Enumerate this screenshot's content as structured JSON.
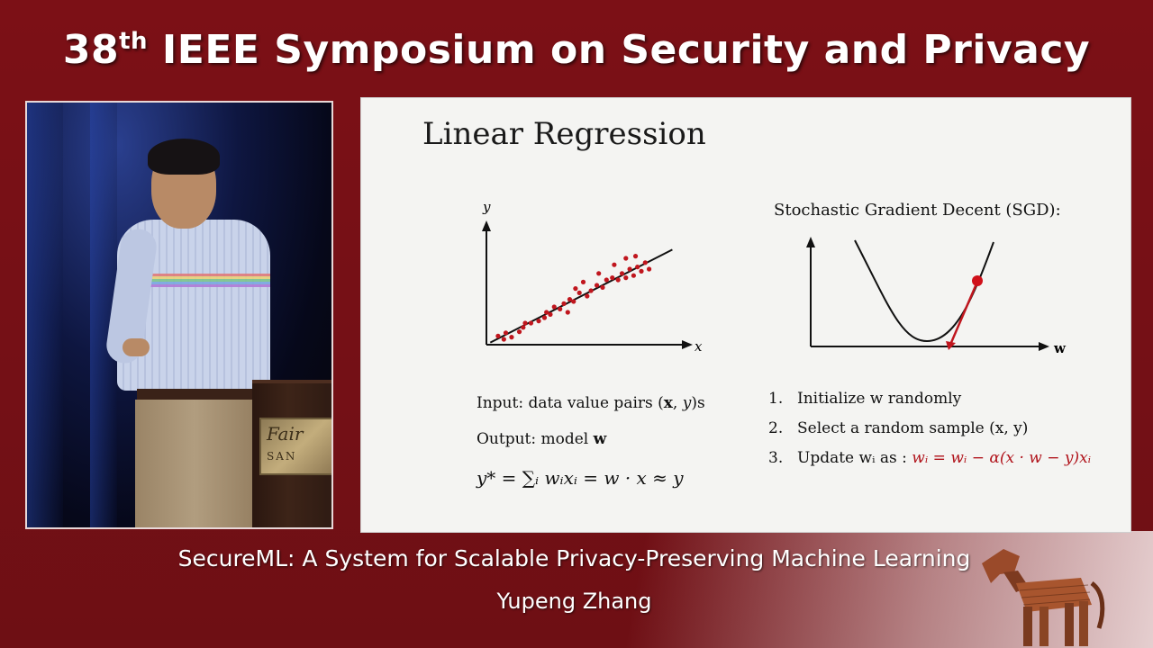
{
  "header": {
    "conference_title_prefix": "38",
    "conference_title_sup": "th",
    "conference_title_rest": " IEEE Symposium on Security and Privacy"
  },
  "video": {
    "podium_text": "Fair",
    "podium_small": "SAN"
  },
  "slide": {
    "title": "Linear Regression",
    "scatter_axis_y": "y",
    "scatter_axis_x": "x",
    "sgd_title": "Stochastic Gradient Decent (SGD):",
    "sgd_axis_x": "w",
    "input_prefix": "Input: data value pairs (",
    "input_bold": "x",
    "input_sep": ", ",
    "input_y": "y",
    "input_suffix": ")s",
    "output_prefix": "Output: model ",
    "output_bold": "w",
    "formula": "y* = ∑ᵢ wᵢxᵢ = w · x ≈ y",
    "steps": [
      {
        "num": "1.",
        "text": "Initialize w randomly"
      },
      {
        "num": "2.",
        "text": "Select a random sample (x, y)"
      },
      {
        "num": "3.",
        "text": "Update wᵢ as :",
        "formula": "wᵢ = wᵢ − α(x · w − y)xᵢ"
      }
    ]
  },
  "chart_data": {
    "type": "scatter",
    "title": "",
    "xlabel": "x",
    "ylabel": "y",
    "points": [
      [
        0.06,
        0.08
      ],
      [
        0.09,
        0.05
      ],
      [
        0.1,
        0.11
      ],
      [
        0.13,
        0.07
      ],
      [
        0.17,
        0.12
      ],
      [
        0.19,
        0.16
      ],
      [
        0.2,
        0.2
      ],
      [
        0.23,
        0.2
      ],
      [
        0.27,
        0.22
      ],
      [
        0.3,
        0.25
      ],
      [
        0.31,
        0.3
      ],
      [
        0.33,
        0.28
      ],
      [
        0.35,
        0.35
      ],
      [
        0.38,
        0.33
      ],
      [
        0.4,
        0.38
      ],
      [
        0.42,
        0.3
      ],
      [
        0.43,
        0.42
      ],
      [
        0.45,
        0.4
      ],
      [
        0.48,
        0.48
      ],
      [
        0.52,
        0.45
      ],
      [
        0.54,
        0.5
      ],
      [
        0.57,
        0.55
      ],
      [
        0.6,
        0.53
      ],
      [
        0.62,
        0.6
      ],
      [
        0.65,
        0.62
      ],
      [
        0.68,
        0.6
      ],
      [
        0.7,
        0.66
      ],
      [
        0.72,
        0.62
      ],
      [
        0.74,
        0.7
      ],
      [
        0.76,
        0.64
      ],
      [
        0.78,
        0.72
      ],
      [
        0.8,
        0.68
      ],
      [
        0.82,
        0.76
      ],
      [
        0.66,
        0.74
      ],
      [
        0.72,
        0.8
      ],
      [
        0.77,
        0.82
      ],
      [
        0.58,
        0.66
      ],
      [
        0.5,
        0.58
      ],
      [
        0.46,
        0.52
      ],
      [
        0.84,
        0.7
      ]
    ],
    "fit_line": {
      "x": [
        0.02,
        0.96
      ],
      "y": [
        0.02,
        0.88
      ]
    }
  },
  "footer": {
    "talk_title": "SecureML: A System for Scalable Privacy-Preserving Machine Learning",
    "speaker": "Yupeng Zhang"
  },
  "colors": {
    "background": "#7c1016",
    "accent_red": "#b0121a",
    "points": "#c0161e"
  }
}
